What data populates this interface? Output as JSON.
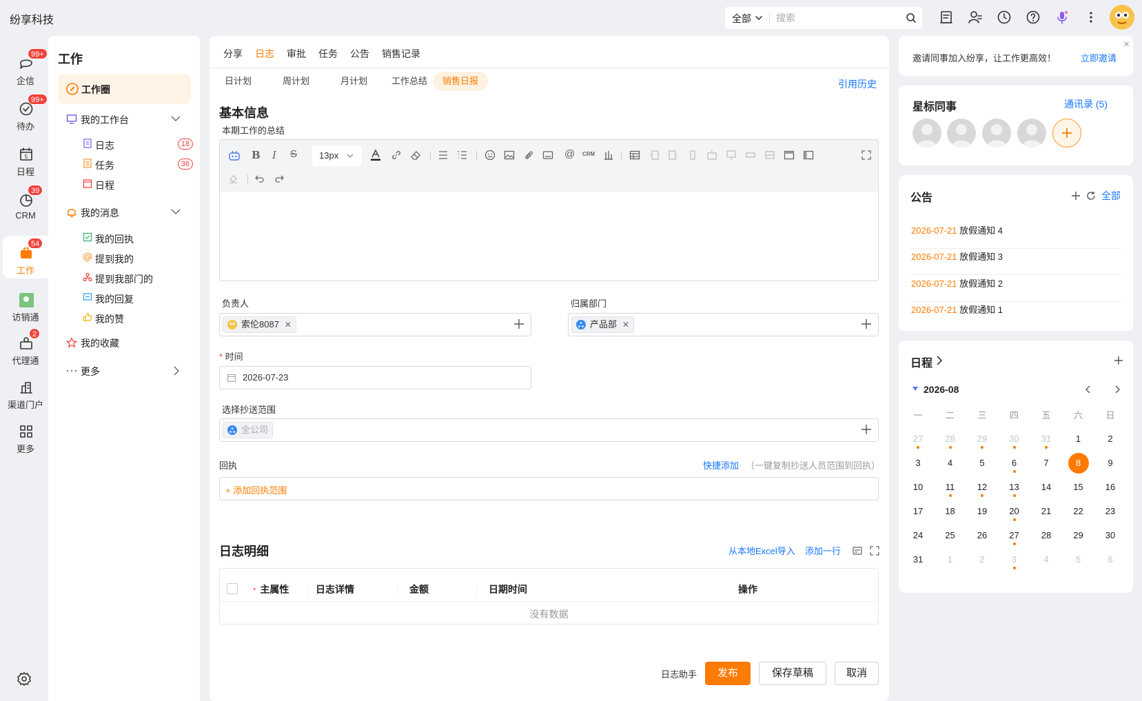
{
  "app": {
    "title": "纷享科技"
  },
  "topbar": {
    "search_scope": "全部",
    "search_placeholder": "搜索"
  },
  "rail": {
    "items": [
      {
        "label": "企信",
        "badge": "99+"
      },
      {
        "label": "待办",
        "badge": "99+"
      },
      {
        "label": "日程",
        "badge": ""
      },
      {
        "label": "CRM",
        "badge": "39"
      },
      {
        "label": "工作",
        "badge": "54"
      },
      {
        "label": "访销通",
        "badge": ""
      },
      {
        "label": "代理通",
        "badge": "2"
      },
      {
        "label": "渠道门户",
        "badge": ""
      },
      {
        "label": "更多",
        "badge": ""
      }
    ]
  },
  "sidebar": {
    "title": "工作",
    "work_circle": "工作圈",
    "workbench": {
      "label": "我的工作台",
      "items": [
        {
          "label": "日志",
          "count": "18"
        },
        {
          "label": "任务",
          "count": "36"
        },
        {
          "label": "日程",
          "count": ""
        }
      ]
    },
    "messages": {
      "label": "我的消息",
      "items": [
        {
          "label": "我的回执"
        },
        {
          "label": "提到我的"
        },
        {
          "label": "提到我部门的"
        },
        {
          "label": "我的回复"
        },
        {
          "label": "我的赞"
        }
      ]
    },
    "favorites": "我的收藏",
    "more": "更多"
  },
  "main": {
    "tabs": [
      "分享",
      "日志",
      "审批",
      "任务",
      "公告",
      "销售记录"
    ],
    "active_tab": "日志",
    "subtabs": [
      "日计划",
      "周计划",
      "月计划",
      "工作总结",
      "销售日报"
    ],
    "active_subtab": "销售日报",
    "cite_history": "引用历史",
    "basic_info_title": "基本信息",
    "summary_label": "本期工作的总结",
    "editor": {
      "font_size": "13px"
    },
    "owner": {
      "label": "负责人",
      "tag": "索伦8087"
    },
    "department": {
      "label": "归属部门",
      "tag": "产品部"
    },
    "time": {
      "label": "时间",
      "value": "2026-07-23"
    },
    "cc": {
      "label": "选择抄送范围",
      "tag": "全公司"
    },
    "receipt": {
      "label": "回执",
      "quick_add": "快捷添加",
      "hint": "（一键复制抄送人员范围到回执）",
      "add": "+ 添加回执范围"
    },
    "detail": {
      "title": "日志明细",
      "import": "从本地Excel导入",
      "add_row": "添加一行",
      "columns": [
        "主属性",
        "日志详情",
        "金额",
        "日期时间",
        "操作"
      ],
      "empty": "没有数据"
    },
    "footer": {
      "assistant": "日志助手",
      "publish": "发布",
      "save_draft": "保存草稿",
      "cancel": "取消"
    }
  },
  "right": {
    "invite": {
      "text": "邀请同事加入纷享，让工作更高效！",
      "link": "立即邀请"
    },
    "starred": {
      "title": "星标同事",
      "contacts_link": "通讯录 (5)"
    },
    "announcements": {
      "title": "公告",
      "all": "全部",
      "items": [
        {
          "date": "2026-07-21",
          "text": "放假通知 4"
        },
        {
          "date": "2026-07-21",
          "text": "放假通知 3"
        },
        {
          "date": "2026-07-21",
          "text": "放假通知 2"
        },
        {
          "date": "2026-07-21",
          "text": "放假通知 1"
        }
      ]
    },
    "schedule": {
      "title": "日程",
      "month": "2026-08",
      "weekdays": [
        "一",
        "二",
        "三",
        "四",
        "五",
        "六",
        "日"
      ],
      "selected_day": "8",
      "weeks": [
        [
          {
            "d": "27",
            "m": true,
            "dot": true
          },
          {
            "d": "28",
            "m": true,
            "dot": true
          },
          {
            "d": "29",
            "m": true,
            "dot": true
          },
          {
            "d": "30",
            "m": true,
            "dot": true
          },
          {
            "d": "31",
            "m": true,
            "dot": true
          },
          {
            "d": "1"
          },
          {
            "d": "2"
          }
        ],
        [
          {
            "d": "3"
          },
          {
            "d": "4"
          },
          {
            "d": "5"
          },
          {
            "d": "6",
            "dot": true
          },
          {
            "d": "7"
          },
          {
            "d": "8",
            "sel": true
          },
          {
            "d": "9"
          }
        ],
        [
          {
            "d": "10"
          },
          {
            "d": "11",
            "dot": true
          },
          {
            "d": "12",
            "dot": true
          },
          {
            "d": "13",
            "dot": true
          },
          {
            "d": "14"
          },
          {
            "d": "15"
          },
          {
            "d": "16"
          }
        ],
        [
          {
            "d": "17"
          },
          {
            "d": "18"
          },
          {
            "d": "19"
          },
          {
            "d": "20",
            "dot": true
          },
          {
            "d": "21"
          },
          {
            "d": "22"
          },
          {
            "d": "23"
          }
        ],
        [
          {
            "d": "24"
          },
          {
            "d": "25"
          },
          {
            "d": "26"
          },
          {
            "d": "27",
            "dot": true
          },
          {
            "d": "28"
          },
          {
            "d": "29"
          },
          {
            "d": "30"
          }
        ],
        [
          {
            "d": "31"
          },
          {
            "d": "1",
            "m": true
          },
          {
            "d": "2",
            "m": true
          },
          {
            "d": "3",
            "m": true,
            "dot": true
          },
          {
            "d": "4",
            "m": true
          },
          {
            "d": "5",
            "m": true
          },
          {
            "d": "6",
            "m": true
          }
        ]
      ]
    }
  }
}
